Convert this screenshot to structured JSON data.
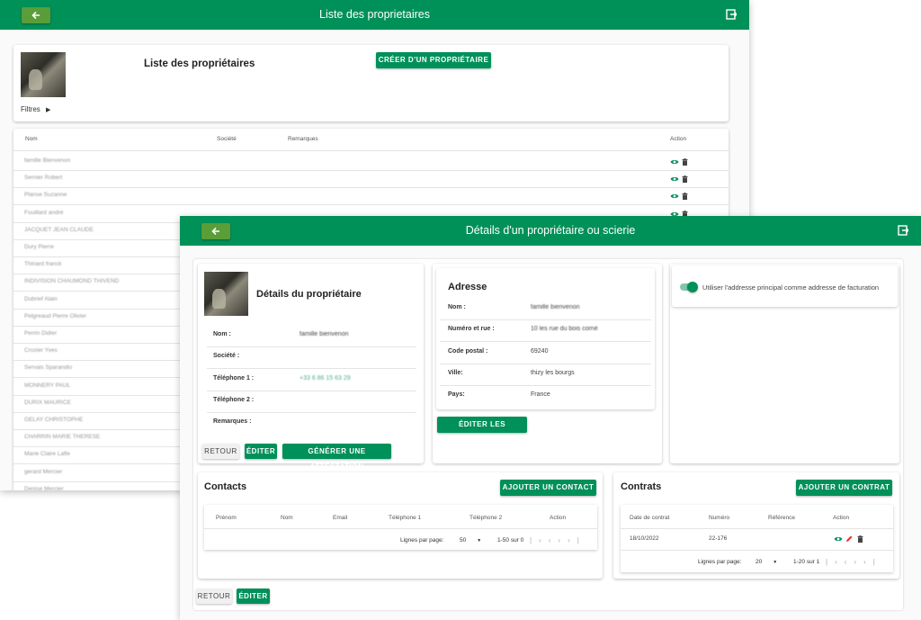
{
  "back_window": {
    "appbar_title": "Liste des proprietaires",
    "page_title": "Liste des propriétaires",
    "create_button": "CRÉER D'UN PROPRIÉTAIRE",
    "filters_label": "Filtres",
    "columns": [
      "Nom",
      "Société",
      "Remarques",
      "Action"
    ],
    "rows": [
      "famille Bienvenon",
      "Sernier Robert",
      "Planse Suzanne",
      "Fouillard andré",
      "JACQUET JEAN CLAUDE",
      "Dury Pierre",
      "Thiriard franck",
      "INDIVISION CHAUMOND THIVEND",
      "Dubrief Alain",
      "Pelgreaud Pierre Olivier",
      "Perrin Didier",
      "Crozier Yves",
      "Servais Sparandio",
      "MONNERY PAUL",
      "DURIX MAURICE",
      "GELAY CHRISTOPHE",
      "CHARRIN MARIE THERESE",
      "Marie Claire Lafle",
      "gerard Mercier",
      "Denise Mercier"
    ]
  },
  "front_window": {
    "appbar_title": "Détails d'un propriétaire ou scierie",
    "owner_card": {
      "title": "Détails du propriétaire",
      "fields": [
        {
          "label": "Nom :",
          "value": "famille bienvenon"
        },
        {
          "label": "Société :",
          "value": ""
        },
        {
          "label": "Téléphone 1 :",
          "value": "+33 6 86 15 63 29"
        },
        {
          "label": "Téléphone 2 :",
          "value": ""
        },
        {
          "label": "Remarques :",
          "value": ""
        }
      ],
      "buttons": {
        "back": "RETOUR",
        "edit": "ÉDITER",
        "generate": "GÉNÉRER UNE ATTESTATION"
      }
    },
    "address_card": {
      "title": "Adresse",
      "fields": [
        {
          "label": "Nom :",
          "value": "famille bienvenon"
        },
        {
          "label": "Numéro et rue :",
          "value": "10 les rue du bois corné"
        },
        {
          "label": "Code postal :",
          "value": "69240"
        },
        {
          "label": "Ville:",
          "value": "thizy les bourgs"
        },
        {
          "label": "Pays:",
          "value": "France"
        }
      ],
      "edit_button": "ÉDITER LES ADRESSES"
    },
    "billing": {
      "toggle_label": "Utiliser l'addresse principal comme addresse de facturation",
      "toggle_on": true
    },
    "contacts": {
      "title": "Contacts",
      "add_button": "AJOUTER UN CONTACT",
      "columns": [
        "Prénom",
        "Nom",
        "Email",
        "Téléphone 1",
        "Téléphone 2",
        "Action"
      ],
      "pagination": {
        "rows_per_page_label": "Lignes par page:",
        "rows_per_page": "50",
        "range": "1-50 sur 0"
      }
    },
    "contracts": {
      "title": "Contrats",
      "add_button": "AJOUTER UN CONTRAT",
      "columns": [
        "Date de contrat",
        "Numéro",
        "Référence",
        "Action"
      ],
      "rows": [
        {
          "date": "18/10/2022",
          "number": "22-176",
          "reference": ""
        }
      ],
      "pagination": {
        "rows_per_page_label": "Lignes par page:",
        "rows_per_page": "20",
        "range": "1-20 sur 1"
      }
    },
    "footer_buttons": {
      "back": "RETOUR",
      "edit": "ÉDITER"
    }
  },
  "colors": {
    "primary": "#009158",
    "back_button": "#5a9e3a",
    "icon_green": "#00905a",
    "pencil_red": "#d33"
  }
}
